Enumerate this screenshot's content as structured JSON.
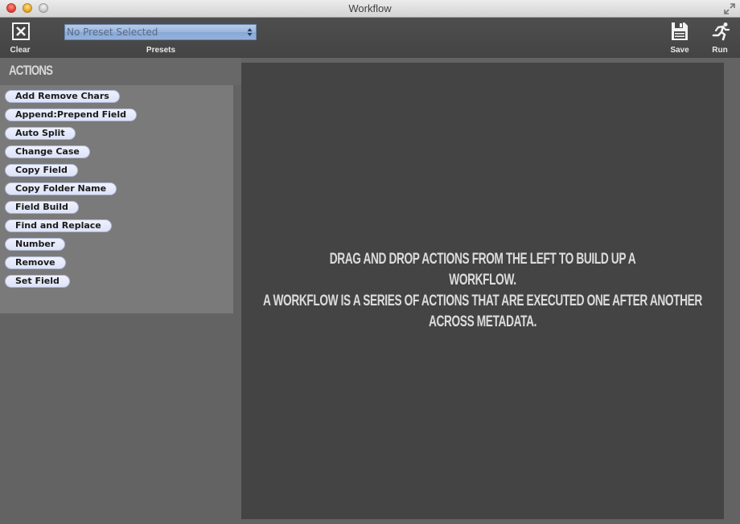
{
  "window": {
    "title": "Workflow"
  },
  "toolbar": {
    "clear_label": "Clear",
    "presets_label": "Presets",
    "preset_selected": "No Preset Selected",
    "save_label": "Save",
    "run_label": "Run"
  },
  "sidebar": {
    "title": "ACTIONS",
    "actions": [
      {
        "label": "Add Remove Chars"
      },
      {
        "label": "Append:Prepend Field"
      },
      {
        "label": "Auto Split"
      },
      {
        "label": "Change Case"
      },
      {
        "label": "Copy Field"
      },
      {
        "label": "Copy Folder Name"
      },
      {
        "label": "Field Build"
      },
      {
        "label": "Find and Replace"
      },
      {
        "label": "Number"
      },
      {
        "label": "Remove"
      },
      {
        "label": "Set Field"
      }
    ]
  },
  "workspace": {
    "instruction": "Drag and drop actions from the left to build up a workflow.",
    "description": "A workflow is a series of actions that are executed one after another across metadata."
  },
  "colors": {
    "pill_fill": "#e3e8fa",
    "preset_select": "#9ab6de",
    "workspace_bg": "#444444",
    "sidebar_bg": "#7a7a7a"
  }
}
